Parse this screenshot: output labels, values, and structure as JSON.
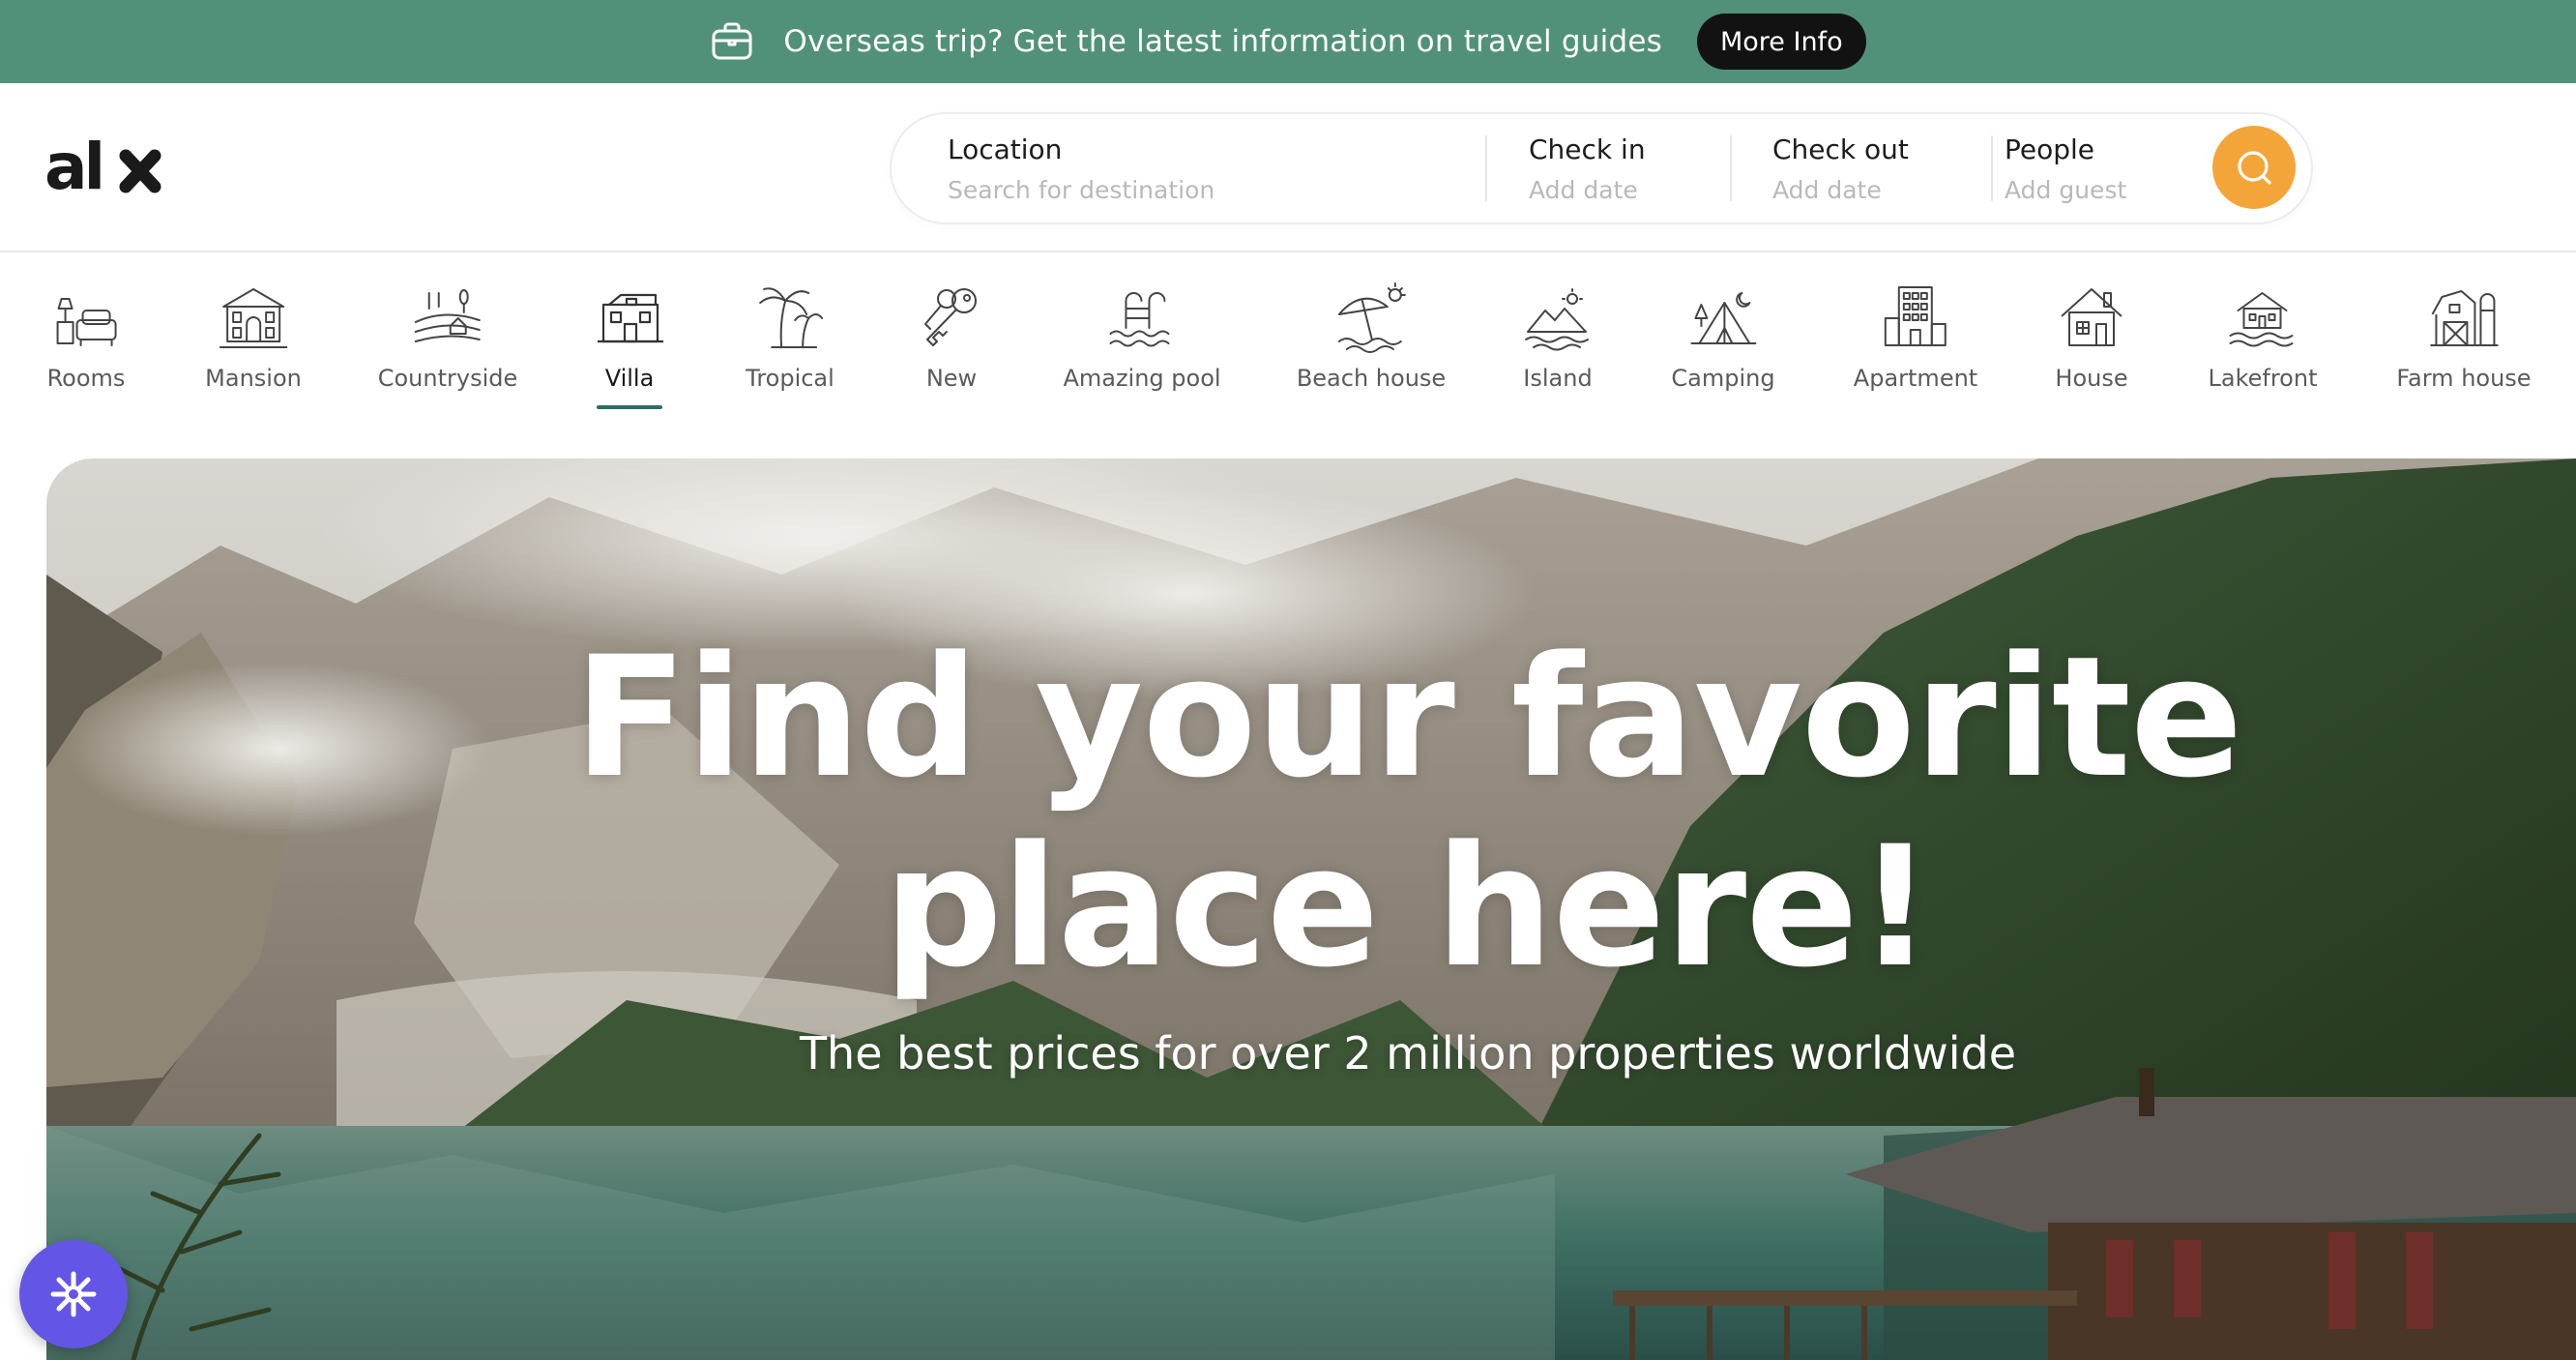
{
  "banner": {
    "text": "Overseas trip? Get the latest information on travel guides",
    "button_label": "More Info",
    "icon": "suitcase-icon",
    "background": "#51917a"
  },
  "header": {
    "logo_text": "alx",
    "search": {
      "location": {
        "label": "Location",
        "placeholder": "Search for destination"
      },
      "check_in": {
        "label": "Check in",
        "placeholder": "Add date"
      },
      "check_out": {
        "label": "Check out",
        "placeholder": "Add date"
      },
      "people": {
        "label": "People",
        "placeholder": "Add guest"
      },
      "button_icon": "search-icon",
      "button_color": "#f4a53a"
    }
  },
  "categories": {
    "active": "Villa",
    "accent": "#2c6e5f",
    "items": [
      {
        "label": "Rooms",
        "icon": "rooms-icon"
      },
      {
        "label": "Mansion",
        "icon": "mansion-icon"
      },
      {
        "label": "Countryside",
        "icon": "countryside-icon"
      },
      {
        "label": "Villa",
        "icon": "villa-icon"
      },
      {
        "label": "Tropical",
        "icon": "palm-tree-icon"
      },
      {
        "label": "New",
        "icon": "keys-icon"
      },
      {
        "label": "Amazing pool",
        "icon": "pool-icon"
      },
      {
        "label": "Beach house",
        "icon": "beach-umbrella-icon"
      },
      {
        "label": "Island",
        "icon": "island-icon"
      },
      {
        "label": "Camping",
        "icon": "tent-icon"
      },
      {
        "label": "Apartment",
        "icon": "apartment-icon"
      },
      {
        "label": "House",
        "icon": "house-icon"
      },
      {
        "label": "Lakefront",
        "icon": "lakefront-icon"
      },
      {
        "label": "Farm house",
        "icon": "barn-icon"
      }
    ]
  },
  "hero": {
    "title_line1": "Find your favorite",
    "title_line2": "place here!",
    "subtitle": "The best prices for over 2 million properties worldwide"
  },
  "widget": {
    "icon": "asterisk-icon",
    "color": "#6356e6"
  }
}
